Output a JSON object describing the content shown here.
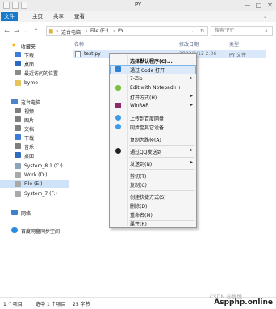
{
  "window": {
    "title": "PY",
    "controls": [
      "—",
      "□",
      "✕"
    ]
  },
  "ribbon": {
    "tabs": [
      "文件",
      "主页",
      "共享",
      "查看"
    ]
  },
  "address": {
    "segments": [
      "这台电脑",
      "File (E:)",
      "PY"
    ],
    "search_placeholder": "搜索\"PY\""
  },
  "nav": {
    "items": [
      {
        "label": "收藏夹",
        "icon": "star-icon",
        "color": "#f0b400"
      },
      {
        "label": "下载",
        "icon": "download-folder-icon",
        "color": "#3b7dd8"
      },
      {
        "label": "桌面",
        "icon": "desktop-icon",
        "color": "#2d6bbf"
      },
      {
        "label": "最近访问的位置",
        "icon": "recent-places-icon",
        "color": "#8a8a8a"
      },
      {
        "label": "byme",
        "icon": "folder-icon",
        "color": "#e8c25a"
      },
      {
        "label": "这台电脑",
        "icon": "computer-icon",
        "color": "#4a86c8"
      },
      {
        "label": "视频",
        "icon": "video-folder-icon",
        "color": "#7e7e7e"
      },
      {
        "label": "图片",
        "icon": "pictures-folder-icon",
        "color": "#7e7e7e"
      },
      {
        "label": "文档",
        "icon": "documents-folder-icon",
        "color": "#7e7e7e"
      },
      {
        "label": "下载",
        "icon": "download-folder-icon",
        "color": "#3b7dd8"
      },
      {
        "label": "音乐",
        "icon": "music-folder-icon",
        "color": "#7e7e7e"
      },
      {
        "label": "桌面",
        "icon": "desktop-icon",
        "color": "#2d6bbf"
      },
      {
        "label": "System_8.1 (C:)",
        "icon": "drive-icon",
        "color": "#8fa3b8"
      },
      {
        "label": "Work (D:)",
        "icon": "drive-icon",
        "color": "#a9a9a9"
      },
      {
        "label": "File (E:)",
        "icon": "drive-icon",
        "color": "#a9a9a9"
      },
      {
        "label": "System_7 (F:)",
        "icon": "drive-icon",
        "color": "#a9a9a9"
      },
      {
        "label": "网络",
        "icon": "network-icon",
        "color": "#3f7fcf"
      },
      {
        "label": "百度网盘同步空间",
        "icon": "cloud-sync-icon",
        "color": "#2a8de0"
      }
    ]
  },
  "list": {
    "columns": [
      "名称",
      "修改日期",
      "类型"
    ],
    "files": [
      {
        "name": "test.py",
        "date": "2022/2/12 2:06",
        "type": "PY 文件"
      }
    ]
  },
  "context_menu": {
    "items": [
      {
        "label": "选择默认程序(C)...",
        "bold": true,
        "icon": "",
        "submenu": false
      },
      {
        "label": "通过 Code 打开",
        "icon": "vscode-icon",
        "submenu": false,
        "highlight": true
      },
      {
        "label": "7-Zip",
        "icon": "",
        "submenu": true
      },
      {
        "label": "Edit with Notepad++",
        "icon": "notepadpp-icon",
        "submenu": false
      },
      {
        "label": "打开方式(H)",
        "icon": "",
        "submenu": true
      },
      {
        "label": "WinRAR",
        "icon": "winrar-icon",
        "submenu": true
      },
      {
        "label": "上传到百度网盘",
        "icon": "baidu-upload-icon",
        "submenu": false
      },
      {
        "label": "同步至其它设备",
        "icon": "baidu-sync-icon",
        "submenu": false
      },
      {
        "label": "复制为路径(A)",
        "icon": "",
        "submenu": false
      },
      {
        "label": "通过QQ发送到",
        "icon": "qq-icon",
        "submenu": true
      },
      {
        "label": "发送到(N)",
        "icon": "",
        "submenu": true
      },
      {
        "label": "剪切(T)",
        "icon": "",
        "submenu": false
      },
      {
        "label": "复制(C)",
        "icon": "",
        "submenu": false
      },
      {
        "label": "创建快捷方式(S)",
        "icon": "",
        "submenu": false
      },
      {
        "label": "删除(D)",
        "icon": "",
        "submenu": false
      },
      {
        "label": "重命名(M)",
        "icon": "",
        "submenu": false
      },
      {
        "label": "属性(R)",
        "icon": "",
        "submenu": false
      }
    ],
    "submenu_arrow": "▸"
  },
  "status": {
    "count": "1 个项目",
    "selected": "选中 1 个项目",
    "size": "25 字节",
    "watermark": "Aspphp.online",
    "watermark_small": "CSDN @悦悦"
  },
  "colors": {
    "accent": "#1979ca",
    "selection": "#d9e8fb",
    "menu_highlight": "#dbe9f8"
  }
}
